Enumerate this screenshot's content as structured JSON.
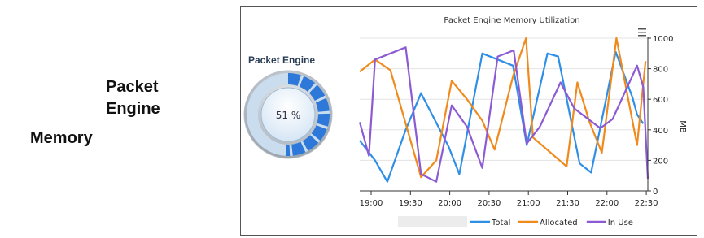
{
  "sidebar": {
    "title_line1": "Packet",
    "title_line2": "Engine",
    "title_line3": "Memory"
  },
  "gauge": {
    "label": "Packet Engine",
    "value_text": "51 %",
    "percent": 51
  },
  "menu_icon": "menu-lines-icon",
  "chart_data": {
    "type": "line",
    "title": "Packet Engine Memory Utilization",
    "ylabel": "MB",
    "ylim": [
      0,
      1000
    ],
    "yticks": [
      0,
      200,
      400,
      600,
      800,
      1000
    ],
    "xtick_labels": [
      "19:00",
      "19:30",
      "20:00",
      "20:30",
      "21:00",
      "21:30",
      "22:00",
      "22:30"
    ],
    "legend_position": "bottom",
    "series": [
      {
        "name": "Total",
        "color": "#2f8fe6",
        "points": [
          [
            0,
            330
          ],
          [
            20,
            200
          ],
          [
            36,
            60
          ],
          [
            60,
            400
          ],
          [
            80,
            640
          ],
          [
            116,
            290
          ],
          [
            130,
            110
          ],
          [
            160,
            900
          ],
          [
            180,
            860
          ],
          [
            200,
            820
          ],
          [
            218,
            300
          ],
          [
            245,
            900
          ],
          [
            259,
            880
          ],
          [
            287,
            180
          ],
          [
            302,
            120
          ],
          [
            334,
            910
          ],
          [
            356,
            610
          ],
          [
            362,
            500
          ],
          [
            370,
            440
          ]
        ]
      },
      {
        "name": "Allocated",
        "color": "#f08a1d",
        "points": [
          [
            0,
            780
          ],
          [
            20,
            860
          ],
          [
            40,
            790
          ],
          [
            80,
            90
          ],
          [
            100,
            200
          ],
          [
            120,
            720
          ],
          [
            140,
            600
          ],
          [
            160,
            460
          ],
          [
            176,
            270
          ],
          [
            200,
            750
          ],
          [
            217,
            1000
          ],
          [
            226,
            350
          ],
          [
            270,
            160
          ],
          [
            284,
            710
          ],
          [
            300,
            450
          ],
          [
            316,
            250
          ],
          [
            335,
            1000
          ],
          [
            362,
            300
          ],
          [
            373,
            850
          ]
        ]
      },
      {
        "name": "In Use",
        "color": "#8c5ad3",
        "points": [
          [
            0,
            450
          ],
          [
            12,
            230
          ],
          [
            20,
            860
          ],
          [
            60,
            940
          ],
          [
            80,
            110
          ],
          [
            100,
            60
          ],
          [
            120,
            560
          ],
          [
            140,
            420
          ],
          [
            160,
            150
          ],
          [
            180,
            880
          ],
          [
            201,
            920
          ],
          [
            218,
            310
          ],
          [
            235,
            420
          ],
          [
            262,
            710
          ],
          [
            280,
            540
          ],
          [
            314,
            410
          ],
          [
            330,
            470
          ],
          [
            362,
            820
          ],
          [
            370,
            680
          ],
          [
            376,
            80
          ]
        ]
      }
    ]
  }
}
